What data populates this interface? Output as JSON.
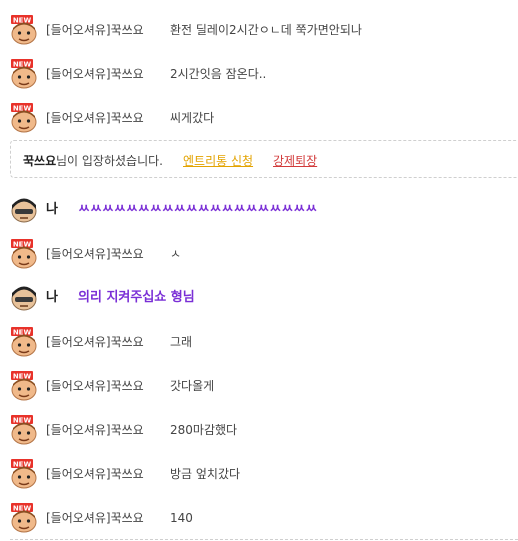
{
  "notice": {
    "user": "꾹쓰요",
    "text": "님이 입장하셨습니다.",
    "entry_link": "엔트리통 신청",
    "kick_link": "강제퇴장"
  },
  "messages": [
    {
      "type": "user",
      "icon": "new-user-avatar-icon",
      "nick": "[들어오셔유]꾹쓰요",
      "text": "환전 딜레이2시간ㅇㄴ데 쭉가면안되나"
    },
    {
      "type": "user",
      "icon": "new-user-avatar-icon",
      "nick": "[들어오셔유]꾹쓰요",
      "text": "2시간잇음 잠온다.."
    },
    {
      "type": "user",
      "icon": "new-user-avatar-icon",
      "nick": "[들어오셔유]꾹쓰요",
      "text": "씨게갔다"
    },
    {
      "type": "me",
      "icon": "my-avatar-icon",
      "nick": "나",
      "text": "ㅆㅆㅆㅆㅆㅆㅆㅆㅆㅆㅆㅆㅆㅆㅆㅆㅆㅆㅆㅆ"
    },
    {
      "type": "user",
      "icon": "new-user-avatar-icon",
      "nick": "[들어오셔유]꾹쓰요",
      "text": "ㅅ"
    },
    {
      "type": "me",
      "icon": "my-avatar-icon",
      "nick": "나",
      "text": "의리 지켜주십쇼 형님"
    },
    {
      "type": "user",
      "icon": "new-user-avatar-icon",
      "nick": "[들어오셔유]꾹쓰요",
      "text": "그래"
    },
    {
      "type": "user",
      "icon": "new-user-avatar-icon",
      "nick": "[들어오셔유]꾹쓰요",
      "text": "갓다올게"
    },
    {
      "type": "user",
      "icon": "new-user-avatar-icon",
      "nick": "[들어오셔유]꾹쓰요",
      "text": "280마감했다"
    },
    {
      "type": "user",
      "icon": "new-user-avatar-icon",
      "nick": "[들어오셔유]꾹쓰요",
      "text": "방금 엎치갔다"
    },
    {
      "type": "user",
      "icon": "new-user-avatar-icon",
      "nick": "[들어오셔유]꾹쓰요",
      "text": "140"
    }
  ],
  "colors": {
    "my_message": "#7a2fd6",
    "entry_link": "#e3a300",
    "kick_link": "#d23a3a",
    "new_badge": "#e8322a"
  }
}
